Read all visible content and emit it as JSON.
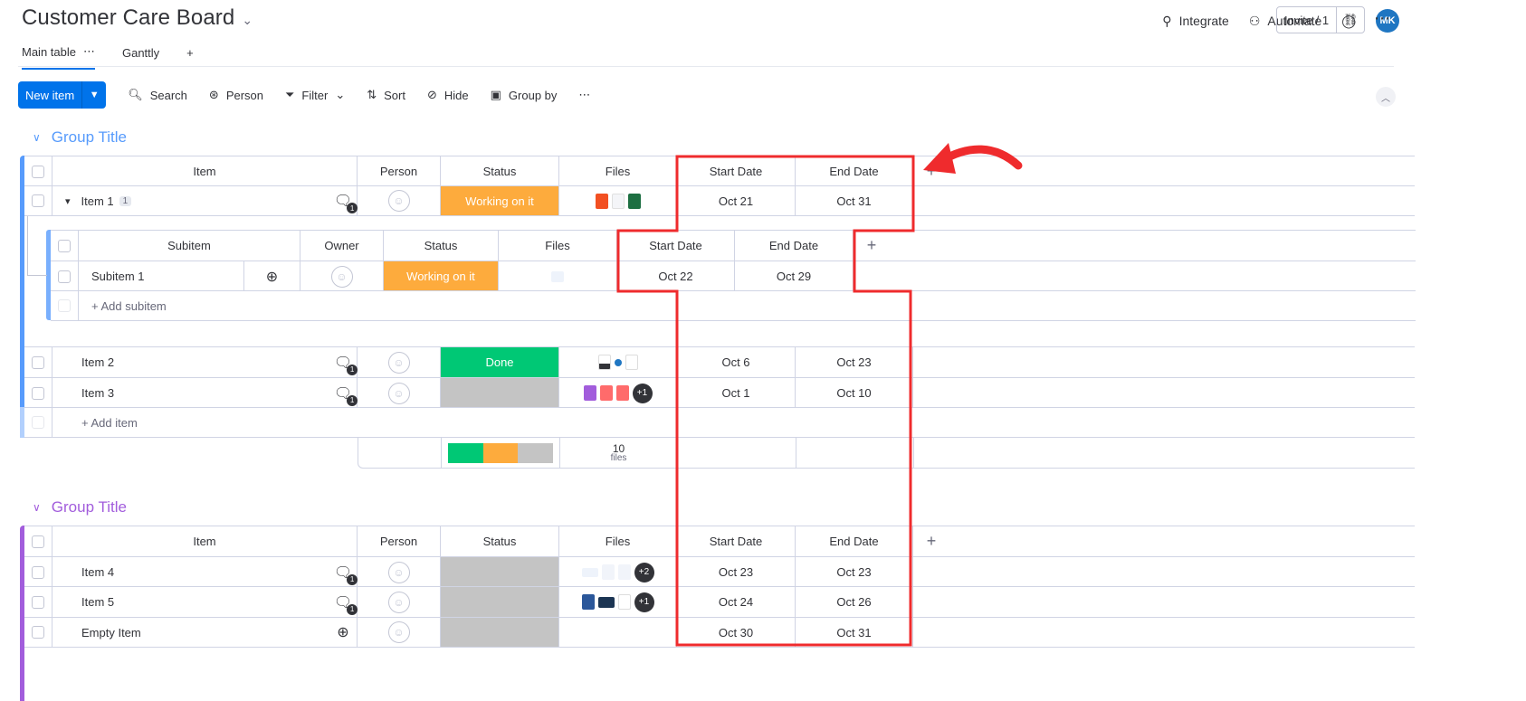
{
  "board": {
    "title": "Customer Care Board"
  },
  "top_actions": {
    "integrate": "Integrate",
    "automate": "Automate",
    "avatar_initials": "MK",
    "invite": "Invite / 1"
  },
  "tabs": [
    {
      "label": "Main table"
    },
    {
      "label": "Ganttly"
    }
  ],
  "toolbar": {
    "new_item": "New item",
    "search": "Search",
    "person": "Person",
    "filter": "Filter",
    "sort": "Sort",
    "hide": "Hide",
    "group_by": "Group by"
  },
  "group1": {
    "title": "Group Title",
    "color": "#579bfc",
    "headers": {
      "item": "Item",
      "person": "Person",
      "status": "Status",
      "files": "Files",
      "start": "Start Date",
      "end": "End Date"
    },
    "item1": {
      "name": "Item 1",
      "count": "1",
      "status": "Working on it",
      "start": "Oct 21",
      "end": "Oct 31"
    },
    "sub_headers": {
      "subitem": "Subitem",
      "owner": "Owner",
      "status": "Status",
      "files": "Files",
      "start": "Start Date",
      "end": "End Date"
    },
    "subitem1": {
      "name": "Subitem 1",
      "status": "Working on it",
      "start": "Oct 22",
      "end": "Oct 29"
    },
    "add_subitem": "+ Add subitem",
    "item2": {
      "name": "Item 2",
      "status": "Done",
      "start": "Oct 6",
      "end": "Oct 23"
    },
    "item3": {
      "name": "Item 3",
      "files_more": "+1",
      "start": "Oct 1",
      "end": "Oct 10"
    },
    "add_item": "+ Add item",
    "summary": {
      "files_count": "10",
      "files_label": "files"
    }
  },
  "group2": {
    "title": "Group Title",
    "color": "#a25ddc",
    "headers": {
      "item": "Item",
      "person": "Person",
      "status": "Status",
      "files": "Files",
      "start": "Start Date",
      "end": "End Date"
    },
    "item4": {
      "name": "Item 4",
      "files_more": "+2",
      "start": "Oct 23",
      "end": "Oct 23"
    },
    "item5": {
      "name": "Item 5",
      "files_more": "+1",
      "start": "Oct 24",
      "end": "Oct 26"
    },
    "empty": {
      "name": "Empty Item",
      "start": "Oct 30",
      "end": "Oct 31"
    }
  }
}
